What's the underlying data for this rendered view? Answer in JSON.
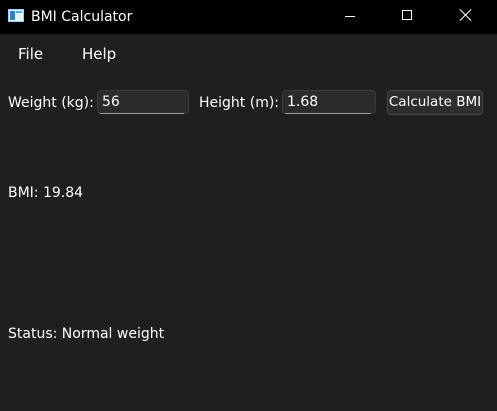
{
  "window": {
    "title": "BMI Calculator",
    "controls": [
      "minimize-icon",
      "maximize-icon",
      "close-icon"
    ]
  },
  "menu": {
    "file": "File",
    "help": "Help"
  },
  "form": {
    "weight_label": "Weight (kg):",
    "weight_value": "56",
    "height_label": "Height (m):",
    "height_value": "1.68",
    "calculate_label": "Calculate BMI"
  },
  "result": {
    "bmi": "BMI: 19.84",
    "status": "Status: Normal weight"
  },
  "colors": {
    "background": "#1f1f1f",
    "titlebar": "#000000",
    "text": "#ffffff"
  }
}
